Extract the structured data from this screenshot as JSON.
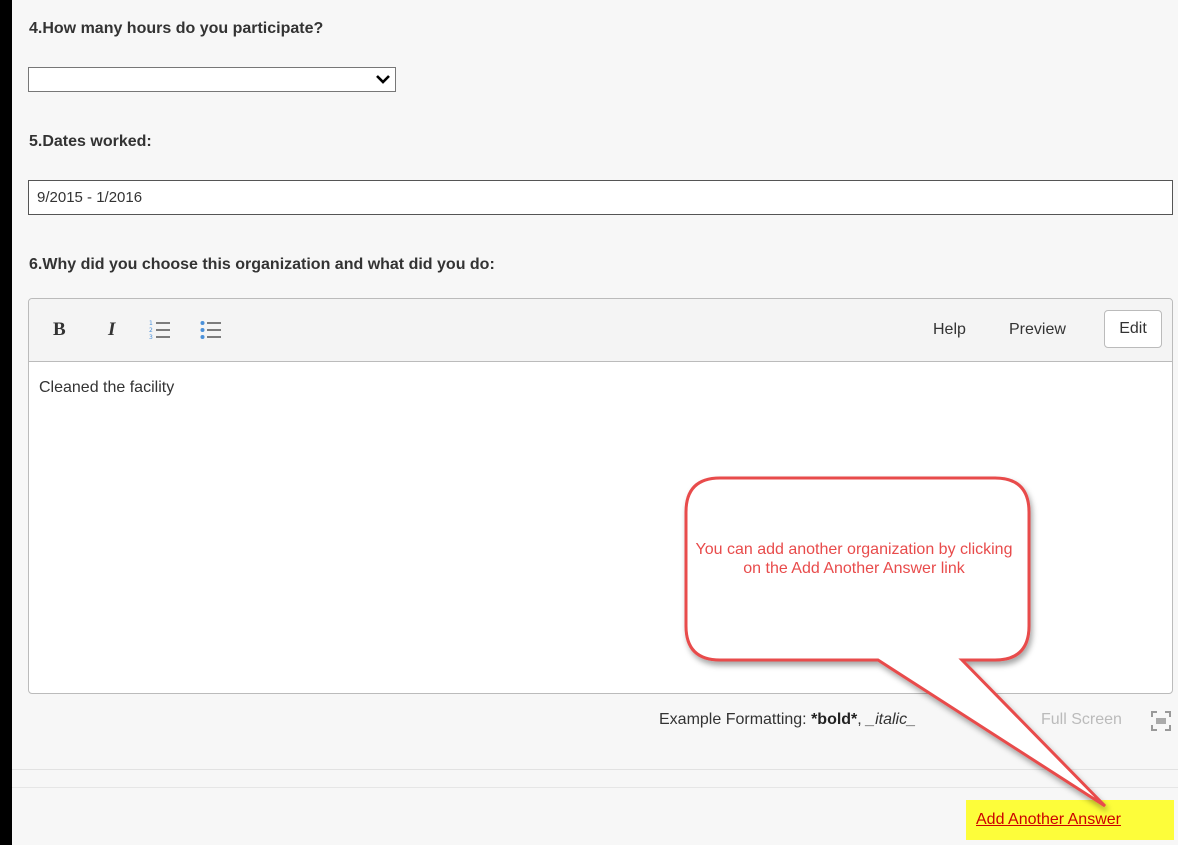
{
  "questions": {
    "q4": {
      "label": "4.How many hours do you participate?",
      "selected": ""
    },
    "q5": {
      "label": "5.Dates worked:",
      "value": "9/2015 - 1/2016"
    },
    "q6": {
      "label": "6.Why did you choose this organization and what did you do:"
    }
  },
  "editor": {
    "toolbar": {
      "bold": "B",
      "italic": "I",
      "help": "Help",
      "preview": "Preview",
      "edit": "Edit"
    },
    "content": "Cleaned the facility",
    "format_hint": {
      "prefix": "Example Formatting: ",
      "bold": "*bold*",
      "separator": ", ",
      "italic": "_italic_"
    },
    "full_screen": "Full Screen"
  },
  "add_another": "Add Another Answer",
  "callout": {
    "text": "You can add another organization by clicking on the Add Another Answer link",
    "color": "#e84b4b"
  },
  "colors": {
    "highlight": "#fdfd3a",
    "link": "#cc0000"
  }
}
